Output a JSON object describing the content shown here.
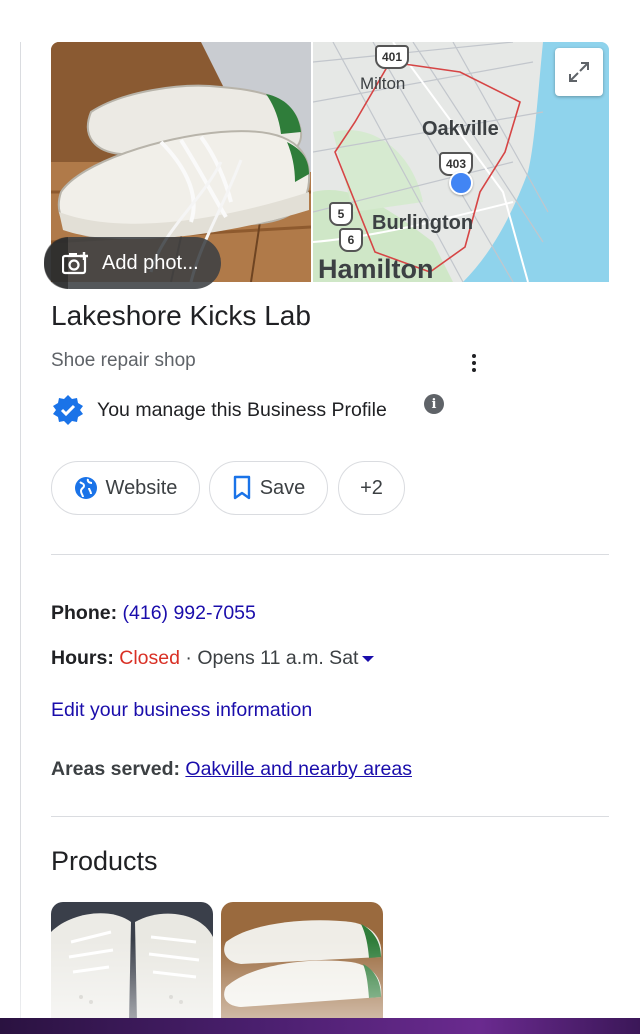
{
  "hero": {
    "add_photo_label": "Add phot...",
    "map": {
      "labels": [
        "Milton",
        "Oakville",
        "Burlington",
        "Hamilton"
      ],
      "highway_shields": [
        "401",
        "403",
        "6",
        "5"
      ]
    }
  },
  "business": {
    "name": "Lakeshore Kicks Lab",
    "category": "Shoe repair shop",
    "managed_text": "You manage this Business Profile"
  },
  "actions": {
    "website_label": "Website",
    "save_label": "Save",
    "more_label": "+2"
  },
  "details": {
    "phone_label": "Phone:",
    "phone_value": "(416) 992-7055",
    "hours_label": "Hours:",
    "hours_status": "Closed",
    "hours_separator": " · ",
    "hours_next": "Opens 11 a.m. Sat",
    "edit_link": "Edit your business information",
    "areas_label": "Areas served:",
    "areas_value": "Oakville and nearby areas"
  },
  "products": {
    "title": "Products"
  },
  "colors": {
    "link": "#1a0dab",
    "closed": "#d93025",
    "verified": "#1a73e8",
    "map_water": "#8fd3ec",
    "service_area_outline": "#d64545"
  }
}
